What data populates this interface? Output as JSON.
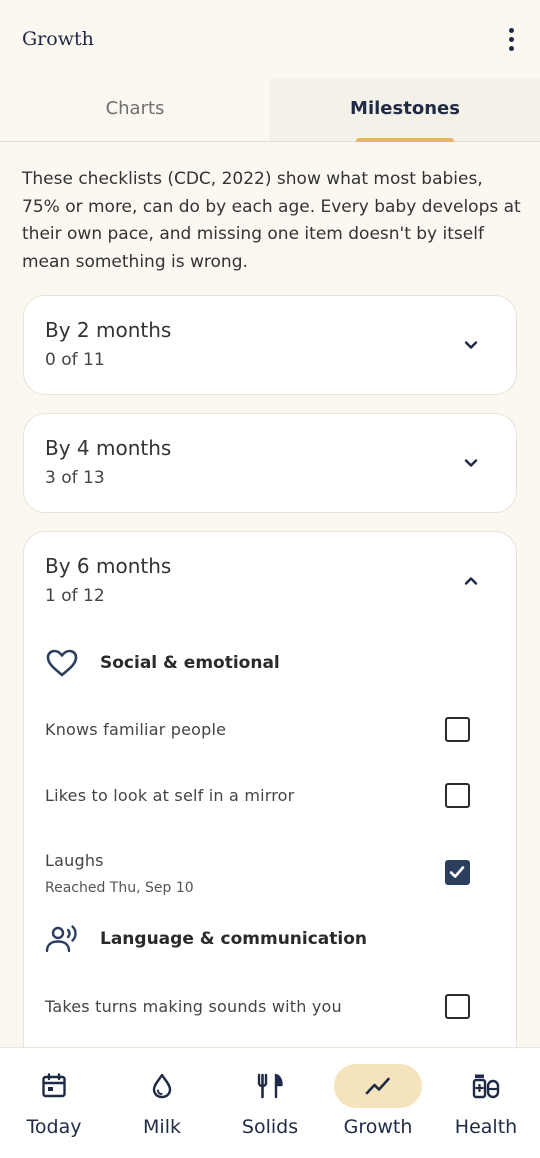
{
  "header": {
    "title": "Growth"
  },
  "tabs": [
    {
      "label": "Charts",
      "active": false
    },
    {
      "label": "Milestones",
      "active": true
    }
  ],
  "intro": "These checklists (CDC, 2022) show what most babies, 75% or more, can do by each age. Every baby develops at their own pace, and missing one item doesn't by itself mean something is wrong.",
  "cards": [
    {
      "title": "By 2 months",
      "count": "0 of 11",
      "expanded": false
    },
    {
      "title": "By 4 months",
      "count": "3 of 13",
      "expanded": false
    },
    {
      "title": "By 6 months",
      "count": "1 of 12",
      "expanded": true,
      "sections": [
        {
          "label": "Social & emotional",
          "icon": "heart-icon",
          "items": [
            {
              "label": "Knows familiar people",
              "checked": false
            },
            {
              "label": "Likes to look at self in a mirror",
              "checked": false
            },
            {
              "label": "Laughs",
              "checked": true,
              "sub": "Reached Thu, Sep 10"
            }
          ]
        },
        {
          "label": "Language & communication",
          "icon": "speaking-person-icon",
          "items": [
            {
              "label": "Takes turns making sounds with you",
              "checked": false
            }
          ]
        }
      ]
    }
  ],
  "nav": [
    {
      "label": "Today",
      "icon": "calendar-icon",
      "active": false
    },
    {
      "label": "Milk",
      "icon": "drop-icon",
      "active": false
    },
    {
      "label": "Solids",
      "icon": "fork-knife-icon",
      "active": false
    },
    {
      "label": "Growth",
      "icon": "trend-icon",
      "active": true
    },
    {
      "label": "Health",
      "icon": "medication-icon",
      "active": false
    }
  ],
  "colors": {
    "background": "#fbf8f1",
    "accent": "#e7b56a",
    "navy": "#1f2a44",
    "checked": "#2c3e5e",
    "active_pill": "#f5e3bd"
  }
}
